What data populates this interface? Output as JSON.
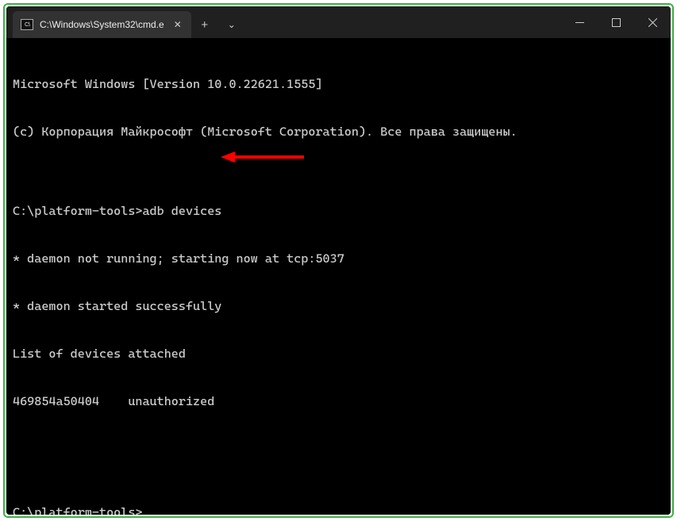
{
  "titlebar": {
    "tab_title": "C:\\Windows\\System32\\cmd.e",
    "cmd_icon_text": "C:\\",
    "close_glyph": "✕",
    "newtab_glyph": "+",
    "dropdown_glyph": "⌄"
  },
  "terminal": {
    "lines": [
      "Microsoft Windows [Version 10.0.22621.1555]",
      "(c) Корпорация Майкрософт (Microsoft Corporation). Все права защищены.",
      "",
      "C:\\platform-tools>adb devices",
      "* daemon not running; starting now at tcp:5037",
      "* daemon started successfully",
      "List of devices attached",
      "469854a50404    unauthorized",
      "",
      "",
      "C:\\platform-tools>"
    ]
  },
  "annotation": {
    "arrow_color": "#ff0000"
  }
}
